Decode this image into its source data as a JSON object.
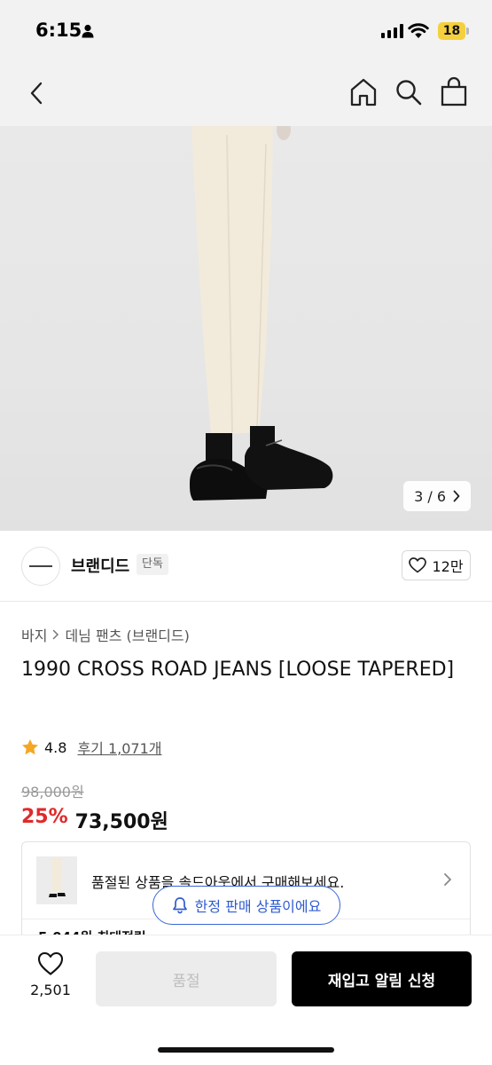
{
  "status_bar": {
    "time": "6:15",
    "battery": "18"
  },
  "nav": {
    "icons": [
      "back-icon",
      "home-icon",
      "search-icon",
      "shopping-bag-icon"
    ]
  },
  "image_viewer": {
    "counter": "3 / 6"
  },
  "brand": {
    "name": "브랜디드",
    "badge": "단독",
    "likes": "12만"
  },
  "breadcrumb": {
    "category": "바지",
    "subcategory": "데님 팬츠 (브랜디드)"
  },
  "product": {
    "title": "1990 CROSS ROAD JEANS [LOOSE TAPERED]",
    "rating": "4.8",
    "reviews": "후기 1,071개",
    "original_price": "98,000원",
    "discount_rate": "25%",
    "sale_price": "73,500원"
  },
  "soldout_notice": {
    "text": "품절된 상품을 솔드아웃에서 구매해보세요.",
    "points": "5,044원 최대적립"
  },
  "limited_badge": {
    "label": "한정 판매 상품이에요"
  },
  "bottom_bar": {
    "wish_count": "2,501",
    "soldout_label": "품절",
    "restock_label": "재입고 알림 신청"
  },
  "colors": {
    "accent_red": "#e02a2a",
    "accent_blue": "#2f5bd0",
    "star": "#f5a623"
  }
}
